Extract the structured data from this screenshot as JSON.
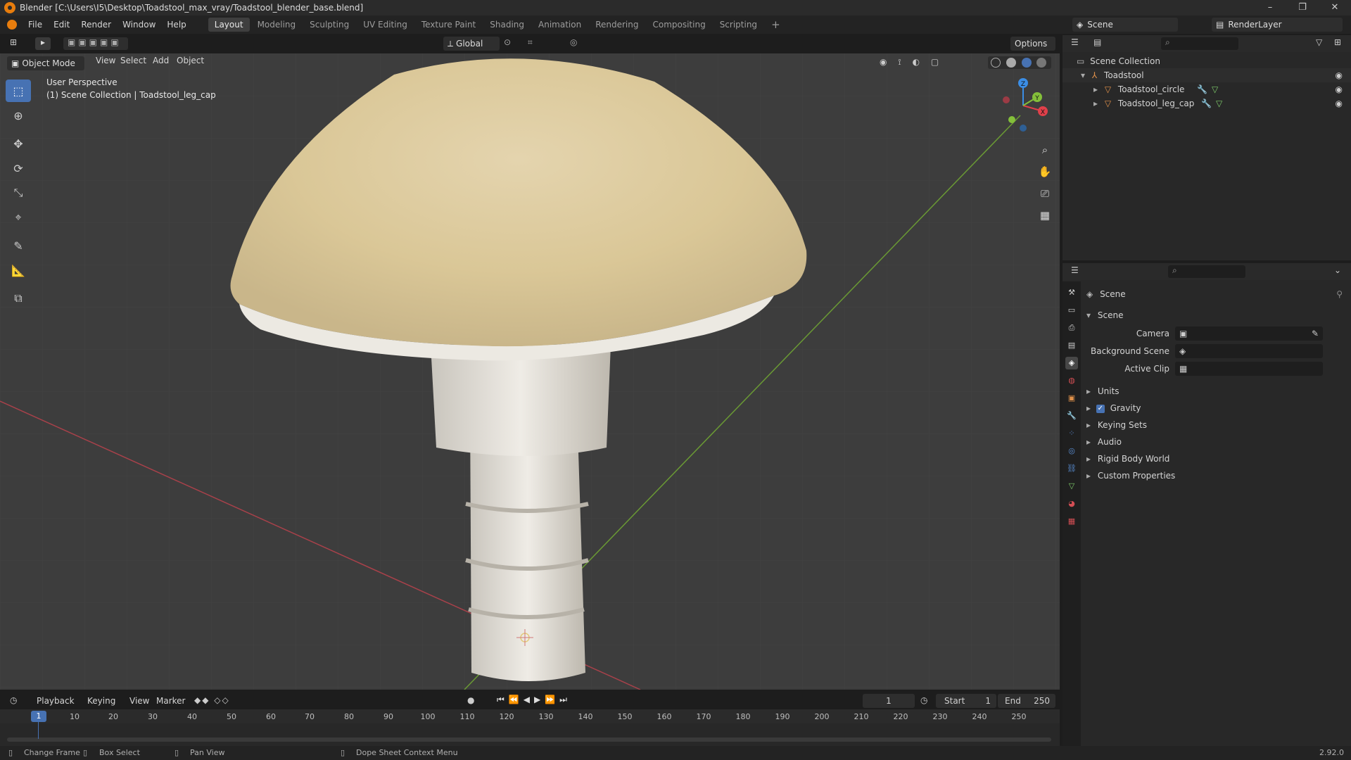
{
  "window": {
    "title": "Blender [C:\\Users\\I5\\Desktop\\Toadstool_max_vray/Toadstool_blender_base.blend]",
    "controls": [
      "–",
      "❐",
      "✕"
    ]
  },
  "menu": [
    "File",
    "Edit",
    "Render",
    "Window",
    "Help"
  ],
  "workspaces": [
    "Layout",
    "Modeling",
    "Sculpting",
    "UV Editing",
    "Texture Paint",
    "Shading",
    "Animation",
    "Rendering",
    "Compositing",
    "Scripting"
  ],
  "active_workspace": "Layout",
  "scene_selector": {
    "scene": "Scene",
    "view_layer": "RenderLayer"
  },
  "viewport_header": {
    "transform_orientation": "Global",
    "options_label": "Options",
    "mode": "Object Mode",
    "menus": [
      "View",
      "Select",
      "Add",
      "Object"
    ]
  },
  "viewport": {
    "perspective_label": "User Perspective",
    "collection_label": "(1) Scene Collection | Toadstool_leg_cap",
    "gizmo_axes": {
      "x": "X",
      "y": "Y",
      "z": "Z"
    }
  },
  "outliner": {
    "root": "Scene Collection",
    "items": [
      {
        "label": "Toadstool"
      },
      {
        "label": "Toadstool_circle"
      },
      {
        "label": "Toadstool_leg_cap"
      }
    ]
  },
  "properties": {
    "context_title": "Scene",
    "panel_title": "Scene",
    "fields": [
      {
        "label": "Camera",
        "value": ""
      },
      {
        "label": "Background Scene",
        "value": ""
      },
      {
        "label": "Active Clip",
        "value": ""
      }
    ],
    "panels": [
      "Units",
      "Gravity",
      "Keying Sets",
      "Audio",
      "Rigid Body World",
      "Custom Properties"
    ],
    "gravity_checked": true
  },
  "timeline": {
    "menus": [
      "Playback",
      "Keying",
      "View",
      "Marker"
    ],
    "current_frame": "1",
    "start_label": "Start",
    "start_value": "1",
    "end_label": "End",
    "end_value": "250",
    "ticks": [
      "10",
      "20",
      "30",
      "40",
      "50",
      "60",
      "70",
      "80",
      "90",
      "100",
      "110",
      "120",
      "130",
      "140",
      "150",
      "160",
      "170",
      "180",
      "190",
      "200",
      "210",
      "220",
      "230",
      "240",
      "250"
    ],
    "playhead": "1"
  },
  "statusbar": {
    "items": [
      "Change Frame",
      "Box Select",
      "Pan View",
      "Dope Sheet Context Menu"
    ],
    "version": "2.92.0"
  },
  "colors": {
    "accent": "#4772b3",
    "x_axis": "#e0404a",
    "y_axis": "#84c03a",
    "z_axis": "#3b8ee6"
  }
}
